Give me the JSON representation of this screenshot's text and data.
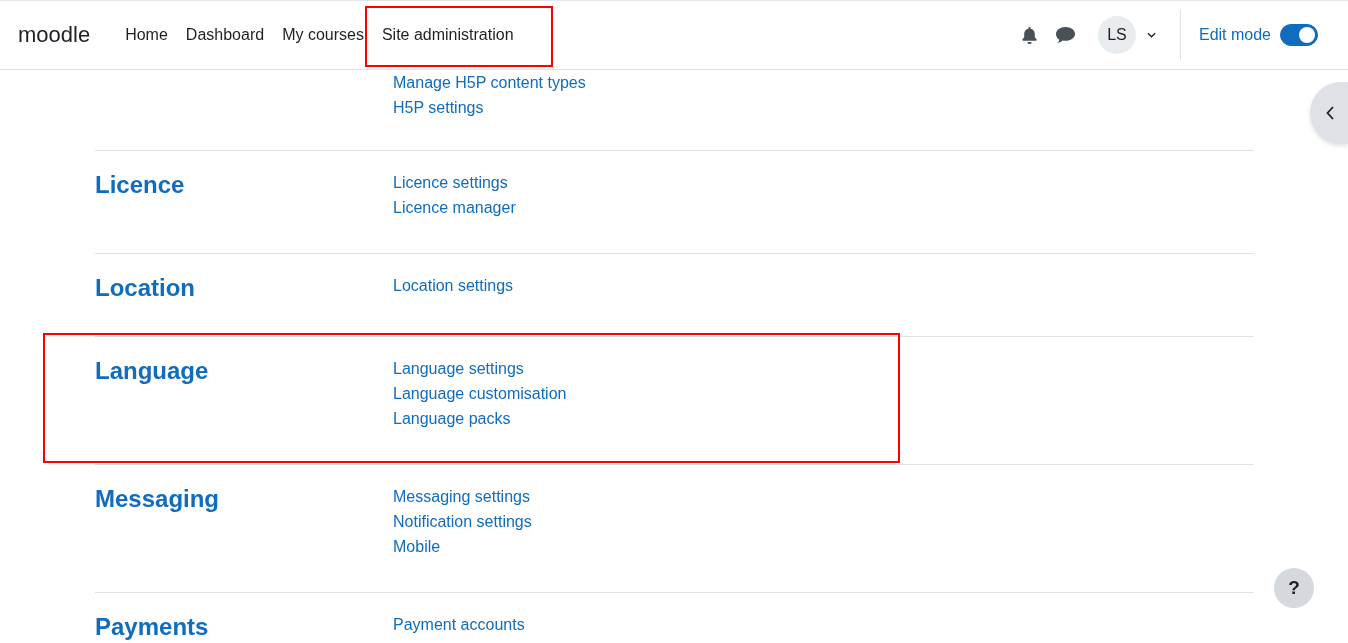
{
  "navbar": {
    "brand": "moodle",
    "items": [
      {
        "label": "Home",
        "highlighted": false
      },
      {
        "label": "Dashboard",
        "highlighted": false
      },
      {
        "label": "My courses",
        "highlighted": false
      },
      {
        "label": "Site administration",
        "highlighted": true
      }
    ],
    "user": {
      "initials": "LS"
    },
    "edit_mode": {
      "label": "Edit mode",
      "on": true
    }
  },
  "sections": [
    {
      "links": [
        "Manage H5P content types",
        "H5P settings"
      ],
      "highlighted": false
    },
    {
      "heading": "Licence",
      "links": [
        "Licence settings",
        "Licence manager"
      ],
      "highlighted": false
    },
    {
      "heading": "Location",
      "links": [
        "Location settings"
      ],
      "highlighted": false
    },
    {
      "heading": "Language",
      "links": [
        "Language settings",
        "Language customisation",
        "Language packs"
      ],
      "highlighted": true
    },
    {
      "heading": "Messaging",
      "links": [
        "Messaging settings",
        "Notification settings",
        "Mobile"
      ],
      "highlighted": false
    },
    {
      "heading": "Payments",
      "links": [
        "Payment accounts"
      ],
      "highlighted": false
    }
  ],
  "help_button": {
    "label": "?"
  }
}
